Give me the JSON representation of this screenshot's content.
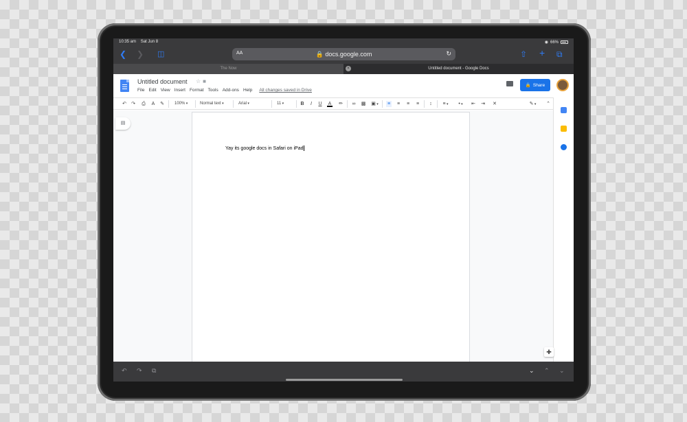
{
  "status_bar": {
    "time": "10:35 am",
    "date": "Sat Jun 8",
    "battery": "66%"
  },
  "safari": {
    "url": "docs.google.com",
    "aa_label": "AA",
    "tabs": [
      {
        "label": "The Now"
      },
      {
        "label": "Untitled document - Google Docs"
      }
    ]
  },
  "docs": {
    "title": "Untitled document",
    "menu": [
      "File",
      "Edit",
      "View",
      "Insert",
      "Format",
      "Tools",
      "Add-ons",
      "Help"
    ],
    "saved_status": "All changes saved in Drive",
    "share_label": "Share",
    "toolbar": {
      "zoom": "100%",
      "style": "Normal text",
      "font": "Arial",
      "size": "11"
    },
    "body_text": "Yay its google docs in Safari on iPad"
  },
  "colors": {
    "accent": "#1a73e8",
    "docs_blue": "#4285f4",
    "safari_blue": "#2f7cf6",
    "safari_chrome": "#3a3a3c"
  }
}
